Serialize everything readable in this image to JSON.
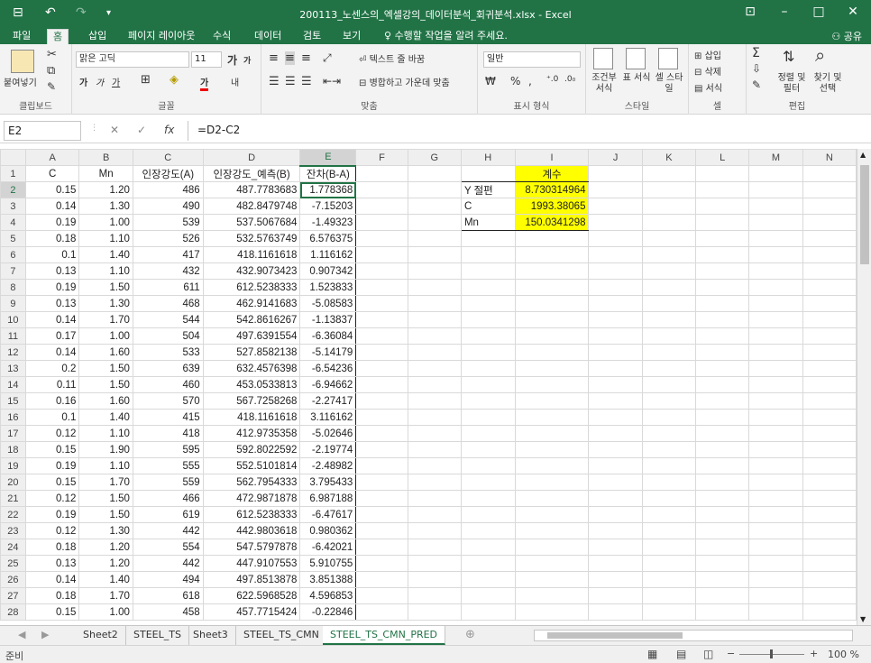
{
  "window": {
    "title": "200113_노센스의_엑셀강의_데이터분석_회귀분석.xlsx - Excel",
    "save_glyph": "⊟",
    "undo_glyph": "↶",
    "redo_glyph": "↷",
    "min_glyph": "–",
    "max_glyph": "□",
    "close_glyph": "✕",
    "ribbon_opt_glyph": "⊡"
  },
  "tabs": [
    "파일",
    "홈",
    "삽입",
    "페이지 레이아웃",
    "수식",
    "데이터",
    "검토",
    "보기"
  ],
  "tell_me": "수행할 작업을 알려 주세요.",
  "share": "공유",
  "ribbon": {
    "clipboard": {
      "paste": "붙여넣기",
      "label": "클립보드"
    },
    "font": {
      "name": "맑은 고딕",
      "size": "11",
      "label": "글꼴"
    },
    "align": {
      "wrap": "텍스트 줄 바꿈",
      "merge": "병합하고 가운데 맞춤",
      "label": "맞춤"
    },
    "number": {
      "format": "일반",
      "label": "표시 형식"
    },
    "styles": {
      "cond": "조건부 서식",
      "table": "표 서식",
      "cell": "셀 스타일",
      "label": "스타일"
    },
    "cells": {
      "insert": "삽입",
      "delete": "삭제",
      "format": "서식",
      "label": "셀"
    },
    "edit": {
      "sort": "정렬 및 필터",
      "find": "찾기 및 선택",
      "label": "편집"
    }
  },
  "formula_bar": {
    "cell_ref": "E2",
    "formula": "=D2-C2",
    "fx": "fx"
  },
  "columns": [
    "A",
    "B",
    "C",
    "D",
    "E",
    "F",
    "G",
    "H",
    "I",
    "J",
    "K",
    "L",
    "M",
    "N"
  ],
  "header_row": [
    "C",
    "Mn",
    "인장강도(A)",
    "인장강도_예측(B)",
    "잔차(B-A)"
  ],
  "rows": [
    [
      "0.15",
      "1.20",
      "486",
      "487.7783683",
      "1.778368"
    ],
    [
      "0.14",
      "1.30",
      "490",
      "482.8479748",
      "-7.15203"
    ],
    [
      "0.19",
      "1.00",
      "539",
      "537.5067684",
      "-1.49323"
    ],
    [
      "0.18",
      "1.10",
      "526",
      "532.5763749",
      "6.576375"
    ],
    [
      "0.1",
      "1.40",
      "417",
      "418.1161618",
      "1.116162"
    ],
    [
      "0.13",
      "1.10",
      "432",
      "432.9073423",
      "0.907342"
    ],
    [
      "0.19",
      "1.50",
      "611",
      "612.5238333",
      "1.523833"
    ],
    [
      "0.13",
      "1.30",
      "468",
      "462.9141683",
      "-5.08583"
    ],
    [
      "0.14",
      "1.70",
      "544",
      "542.8616267",
      "-1.13837"
    ],
    [
      "0.17",
      "1.00",
      "504",
      "497.6391554",
      "-6.36084"
    ],
    [
      "0.14",
      "1.60",
      "533",
      "527.8582138",
      "-5.14179"
    ],
    [
      "0.2",
      "1.50",
      "639",
      "632.4576398",
      "-6.54236"
    ],
    [
      "0.11",
      "1.50",
      "460",
      "453.0533813",
      "-6.94662"
    ],
    [
      "0.16",
      "1.60",
      "570",
      "567.7258268",
      "-2.27417"
    ],
    [
      "0.1",
      "1.40",
      "415",
      "418.1161618",
      "3.116162"
    ],
    [
      "0.12",
      "1.10",
      "418",
      "412.9735358",
      "-5.02646"
    ],
    [
      "0.15",
      "1.90",
      "595",
      "592.8022592",
      "-2.19774"
    ],
    [
      "0.19",
      "1.10",
      "555",
      "552.5101814",
      "-2.48982"
    ],
    [
      "0.15",
      "1.70",
      "559",
      "562.7954333",
      "3.795433"
    ],
    [
      "0.12",
      "1.50",
      "466",
      "472.9871878",
      "6.987188"
    ],
    [
      "0.19",
      "1.50",
      "619",
      "612.5238333",
      "-6.47617"
    ],
    [
      "0.12",
      "1.30",
      "442",
      "442.9803618",
      "0.980362"
    ],
    [
      "0.18",
      "1.20",
      "554",
      "547.5797878",
      "-6.42021"
    ],
    [
      "0.13",
      "1.20",
      "442",
      "447.9107553",
      "5.910755"
    ],
    [
      "0.14",
      "1.40",
      "494",
      "497.8513878",
      "3.851388"
    ],
    [
      "0.18",
      "1.70",
      "618",
      "622.5968528",
      "4.596853"
    ],
    [
      "0.15",
      "1.00",
      "458",
      "457.7715424",
      "-0.22846"
    ]
  ],
  "coef": {
    "header": "계수",
    "items": [
      {
        "label": "Y 절편",
        "value": "8.730314964"
      },
      {
        "label": "C",
        "value": "1993.38065"
      },
      {
        "label": "Mn",
        "value": "150.0341298"
      }
    ]
  },
  "sheets": [
    "Sheet2",
    "STEEL_TS",
    "Sheet3",
    "STEEL_TS_CMN",
    "STEEL_TS_CMN_PRED"
  ],
  "active_sheet": "STEEL_TS_CMN_PRED",
  "status": {
    "mode": "준비",
    "zoom": "100 %"
  }
}
